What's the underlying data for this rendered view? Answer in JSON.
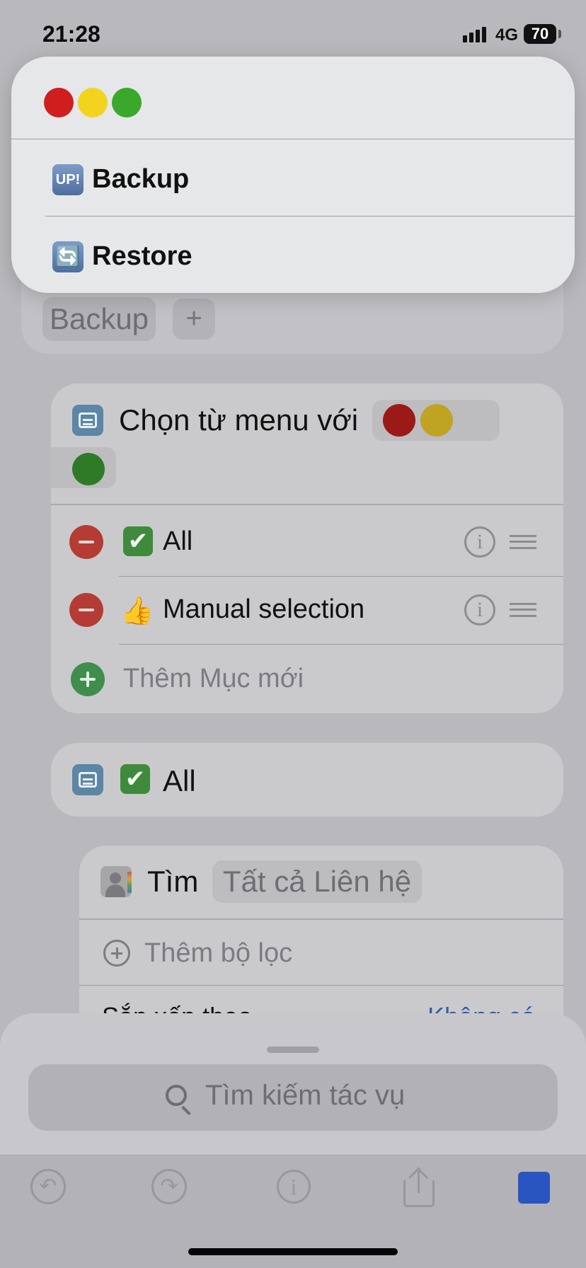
{
  "status_bar": {
    "time": "21:28",
    "network": "4G",
    "battery": "70"
  },
  "background_editor": {
    "top_block": {
      "token_label": "Backup",
      "add_token_label": "+"
    },
    "choose_menu": {
      "title": "Chọn từ menu với",
      "title_tokens": [
        "red-circle-emoji",
        "yellow-circle-emoji",
        "green-circle-emoji"
      ],
      "items": [
        {
          "emoji": "✔",
          "label": "All"
        },
        {
          "emoji": "👍",
          "label": "Manual selection"
        }
      ],
      "add_item_label": "Thêm Mục mới"
    },
    "case_block": {
      "emoji": "✔",
      "label": "All"
    },
    "find_block": {
      "title": "Tìm",
      "target_token": "Tất cả Liên hệ",
      "add_filter_label": "Thêm bộ lọc",
      "sort_label": "Sắp xếp theo",
      "sort_value": "Không có"
    },
    "action_search": {
      "placeholder": "Tìm kiếm tác vụ"
    }
  },
  "toolbar": {
    "icons": [
      "undo-icon",
      "redo-icon",
      "info-icon",
      "share-icon",
      "run-icon"
    ],
    "accent_color": "#2855c0"
  },
  "popup_menu": {
    "header_tokens": [
      "red-circle-emoji",
      "yellow-circle-emoji",
      "green-circle-emoji"
    ],
    "items": [
      {
        "icon_text": "UP!",
        "label": "Backup"
      },
      {
        "icon_text": "🔄",
        "label": "Restore"
      }
    ]
  },
  "colors": {
    "red_dot": "#d01e1e",
    "yellow_dot": "#f2d41f",
    "green_dot": "#3aa82a",
    "minus_button": "#b43c34",
    "add_button": "#3f8e4c",
    "link": "#2f5fad"
  }
}
